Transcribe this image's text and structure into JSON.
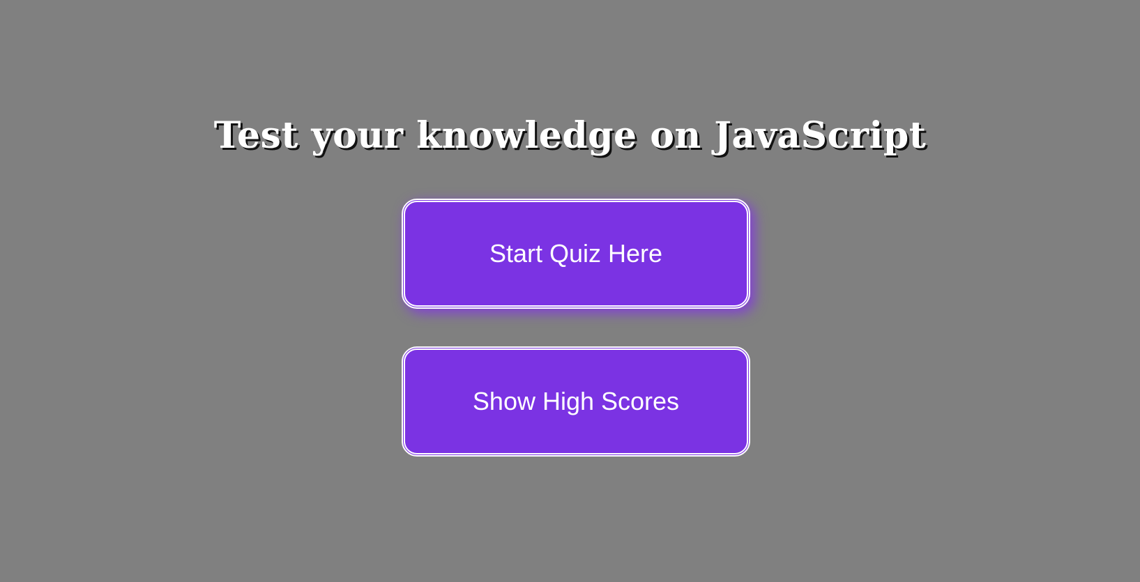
{
  "page": {
    "title": "Test your knowledge on JavaScript",
    "background_color": "#808080"
  },
  "buttons": {
    "start_quiz": "Start Quiz Here",
    "high_scores": "Show High Scores"
  },
  "colors": {
    "button_fill": "#7b33e3",
    "button_border": "#ffffff",
    "text": "#ffffff"
  }
}
